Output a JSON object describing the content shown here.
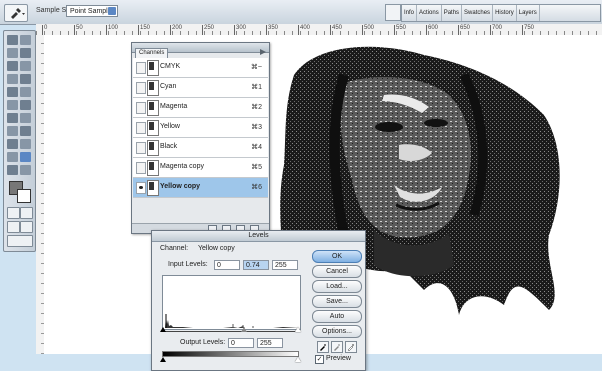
{
  "options_bar": {
    "tool_icon": "eyedropper-icon",
    "sample_size_label": "Sample Size:",
    "sample_size_value": "Point Sample",
    "palette_tabs": [
      "Info",
      "Actions",
      "Paths",
      "Swatches",
      "History",
      "Layers"
    ]
  },
  "ruler": {
    "numbers": [
      "0",
      "50",
      "100",
      "150",
      "200",
      "250",
      "300",
      "350",
      "400",
      "450",
      "500",
      "550",
      "600",
      "650",
      "700",
      "750"
    ]
  },
  "channels_panel": {
    "tab_label": "Channels",
    "channels": [
      {
        "name": "CMYK",
        "shortcut": "⌘~",
        "visible": false,
        "selected": false
      },
      {
        "name": "Cyan",
        "shortcut": "⌘1",
        "visible": false,
        "selected": false
      },
      {
        "name": "Magenta",
        "shortcut": "⌘2",
        "visible": false,
        "selected": false
      },
      {
        "name": "Yellow",
        "shortcut": "⌘3",
        "visible": false,
        "selected": false
      },
      {
        "name": "Black",
        "shortcut": "⌘4",
        "visible": false,
        "selected": false
      },
      {
        "name": "Magenta copy",
        "shortcut": "⌘5",
        "visible": false,
        "selected": false
      },
      {
        "name": "Yellow copy",
        "shortcut": "⌘6",
        "visible": true,
        "selected": true
      }
    ]
  },
  "levels_dialog": {
    "title": "Levels",
    "channel_label": "Channel:",
    "channel_value": "Yellow copy",
    "input_levels_label": "Input Levels:",
    "input_levels": [
      "0",
      "0.74",
      "255"
    ],
    "output_levels_label": "Output Levels:",
    "output_levels": [
      "0",
      "255"
    ],
    "buttons": {
      "ok": "OK",
      "cancel": "Cancel",
      "load": "Load...",
      "save": "Save...",
      "auto": "Auto",
      "options": "Options..."
    },
    "preview_label": "Preview",
    "preview_checked": true
  },
  "colors": {
    "selection_highlight": "#9ec6ea",
    "ok_button": "#7fb0e2",
    "background": "#cfe3f2"
  }
}
